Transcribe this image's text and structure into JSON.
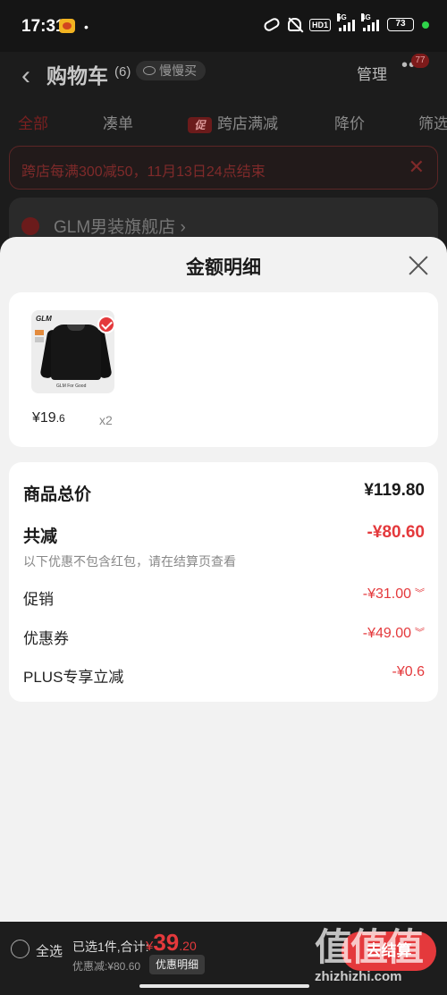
{
  "status_bar": {
    "time": "17:31",
    "dot": "•",
    "hd": "HD1",
    "signal_1_tag": "5G",
    "signal_2_tag": "4G",
    "battery": "73"
  },
  "background": {
    "back_glyph": "‹",
    "title": "购物车",
    "count": "(6)",
    "slow_buy": "慢慢买",
    "manage": "管理",
    "more_glyph": "•••",
    "badge": "77",
    "tabs": [
      {
        "label": "全部",
        "active": true
      },
      {
        "label": "凑单"
      },
      {
        "tag": "促",
        "label": "跨店满减"
      },
      {
        "label": "降价"
      },
      {
        "label": "筛选"
      }
    ],
    "notice": "跨店每满300减50，11月13日24点结束",
    "notice_close": "✕",
    "store_name": "GLM男装旗舰店 ›"
  },
  "sheet": {
    "title": "金额明细",
    "product": {
      "thumb_brand": "GLM",
      "thumb_caption": "GLM For Good",
      "price_int": "¥19",
      "price_dec": ".6",
      "qty": "x2"
    },
    "summary": {
      "total_label": "商品总价",
      "total_value": "¥119.80",
      "minus_label": "共减",
      "minus_value": "-¥80.60",
      "note": "以下优惠不包含红包，请在结算页查看",
      "promo_label": "促销",
      "promo_value": "-¥31.00",
      "coupon_label": "优惠券",
      "coupon_value": "-¥49.00",
      "plus_label": "PLUS专享立减",
      "plus_value": "-¥0.6",
      "chevron": "︾"
    }
  },
  "bottom_bar": {
    "select_all": "全选",
    "selected_text": "已选1件,合计:",
    "price_currency": "¥",
    "price_int": "39",
    "price_dec": ".20",
    "discount_text": "优惠减:¥80.60",
    "detail_button": "优惠明细",
    "checkout_button": "去结算"
  },
  "watermark": {
    "glyphs": "值值值",
    "url": "zhizhizhi.com"
  },
  "colors": {
    "accent": "#e4393c",
    "sheet_bg": "#f2f2f2",
    "page_bg": "#1e1e1e"
  }
}
